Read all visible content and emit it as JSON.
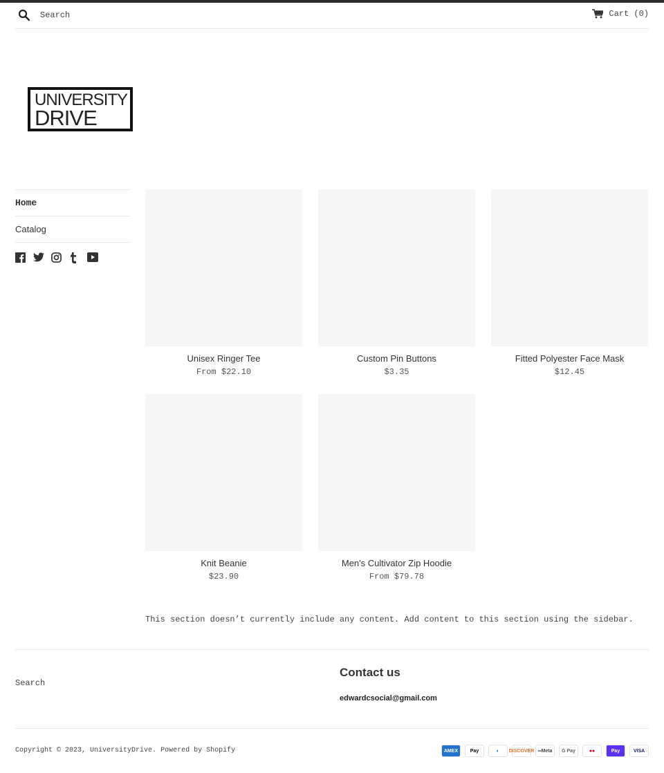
{
  "header": {
    "search_placeholder": "Search",
    "search_icon": "search-icon",
    "cart_label": "Cart (0)",
    "cart_icon": "cart-icon"
  },
  "logo": {
    "line1": "UNIVERSITY",
    "line2": "DRIVE"
  },
  "sidebar": {
    "items": [
      {
        "label": "Home",
        "active": true
      },
      {
        "label": "Catalog",
        "active": false
      }
    ],
    "social": [
      "facebook-icon",
      "twitter-icon",
      "instagram-icon",
      "tumblr-icon",
      "youtube-icon"
    ]
  },
  "products": [
    {
      "title": "Unisex Ringer Tee",
      "price": "From $22.10"
    },
    {
      "title": "Custom Pin Buttons",
      "price": "$3.35"
    },
    {
      "title": "Fitted Polyester Face Mask",
      "price": "$12.45"
    },
    {
      "title": "Knit Beanie",
      "price": "$23.90"
    },
    {
      "title": "Men's Cultivator Zip Hoodie",
      "price": "From $79.78"
    }
  ],
  "empty_section_message": "This section doesn’t currently include any content. Add content to this section using the sidebar.",
  "footer": {
    "search_link": "Search",
    "contact_title": "Contact us",
    "contact_email": "edwardcsocial@gmail.com",
    "copyright_prefix": "Copyright © 2023, ",
    "store_name": "UniversityDrive",
    "powered_by": "Powered by Shopify",
    "payment_methods": [
      {
        "name": "American Express",
        "label": "AMEX",
        "bg": "#1f72cd",
        "fg": "#ffffff"
      },
      {
        "name": "Apple Pay",
        "label": "Pay",
        "bg": "#ffffff",
        "fg": "#000000"
      },
      {
        "name": "Diners Club",
        "label": "◐",
        "bg": "#ffffff",
        "fg": "#0165ac"
      },
      {
        "name": "Discover",
        "label": "DISCOVER",
        "bg": "#ffffff",
        "fg": "#e8772e"
      },
      {
        "name": "Meta Pay",
        "label": "∞Meta",
        "bg": "#ffffff",
        "fg": "#444444"
      },
      {
        "name": "Google Pay",
        "label": "G Pay",
        "bg": "#ffffff",
        "fg": "#5f6368"
      },
      {
        "name": "Mastercard",
        "label": "●●",
        "bg": "#ffffff",
        "fg": "#eb001b"
      },
      {
        "name": "Shop Pay",
        "label": "Pay",
        "bg": "#5a31f4",
        "fg": "#ffffff"
      },
      {
        "name": "Visa",
        "label": "VISA",
        "bg": "#ffffff",
        "fg": "#1a1f71"
      }
    ]
  }
}
